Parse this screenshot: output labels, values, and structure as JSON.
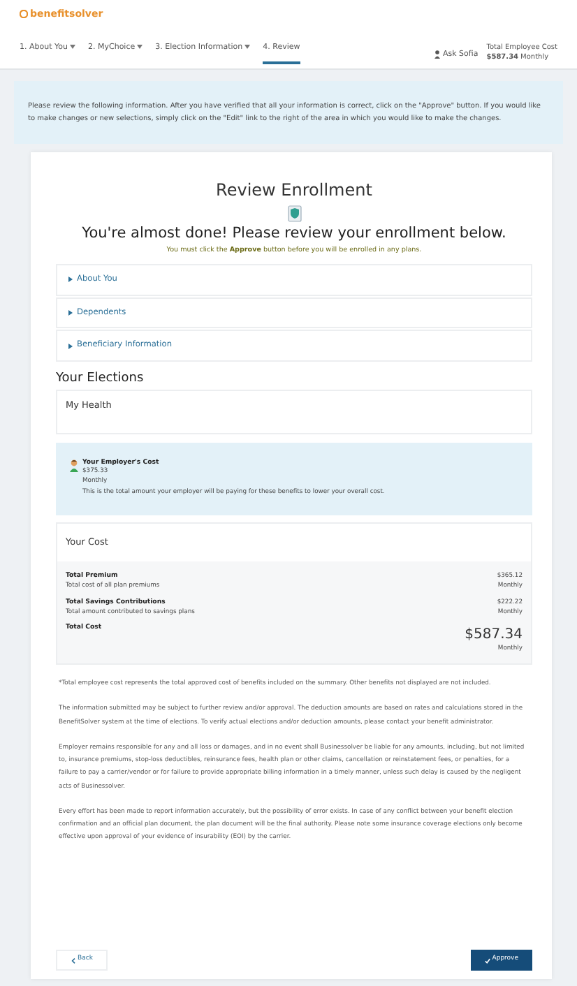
{
  "header": {
    "logo": "benefitsolver",
    "steps": [
      {
        "label": "1. About You",
        "has_menu": true,
        "selected": false
      },
      {
        "label": "2. MyChoice",
        "has_menu": true,
        "selected": false
      },
      {
        "label": "3. Election Information",
        "has_menu": true,
        "selected": false
      },
      {
        "label": "4. Review",
        "has_menu": false,
        "selected": true
      }
    ],
    "help_link": "Ask Sofia",
    "total_label": "Total Employee Cost",
    "total_amount": "$587.34",
    "total_period": "Monthly"
  },
  "banner": "Please review the following information. After you have verified that all your information is correct, click on the \"Approve\" button. If you would like to make changes or new selections, simply click on the \"Edit\" link to the right of the area in which you would like to make the changes.",
  "review": {
    "title": "Review Enrollment",
    "heading": "You're almost done! Please review your enrollment below.",
    "note": "You must click the **Approve** button before you will be enrolled in any plans.",
    "sections": [
      {
        "label": "About You",
        "expanded": false
      },
      {
        "label": "Dependents",
        "expanded": false
      },
      {
        "label": "Beneficiary Information",
        "expanded": false
      }
    ]
  },
  "elections": {
    "title": "Your Elections",
    "group": "My Health",
    "employer": {
      "title": "Your Employer's Cost",
      "amount": "$375.33",
      "period": "Monthly",
      "description": "This is the total amount your employer will be paying for these benefits to lower your overall cost."
    },
    "cost": {
      "title": "Your Cost",
      "rows": [
        {
          "kind": "line",
          "label": "Total Premium",
          "sublabel": "Total cost of all plan premiums",
          "amount": "$365.12",
          "period": "Monthly"
        },
        {
          "kind": "line",
          "label": "Total Savings Contributions",
          "sublabel": "Total amount contributed to savings plans",
          "amount": "$222.22",
          "period": "Monthly"
        },
        {
          "kind": "total",
          "label": "Total Cost",
          "amount": "$587.34",
          "period": "Monthly"
        }
      ]
    }
  },
  "disclaimers": [
    "*Total employee cost represents the total approved cost of benefits included on the summary. Other benefits not displayed are not included.",
    "The information submitted may be subject to further review and/or approval. The deduction amounts are based on rates and calculations stored in the BenefitSolver system at the time of elections. To verify actual elections and/or deduction amounts, please contact your benefit administrator.",
    "Employer remains responsible for any and all loss or damages, and in no event shall Businessolver be liable for any amounts, including, but not limited to, insurance premiums, stop-loss deductibles, reinsurance fees, health plan or other claims, cancellation or reinstatement fees, or penalties, for a failure to pay a carrier/vendor or for failure to provide appropriate billing information in a timely manner, unless such delay is caused by the negligent acts of Businessolver.",
    "Every effort has been made to report information accurately, but the possibility of error exists. In case of any conflict between your benefit election confirmation and an official plan document, the plan document will be the final authority. Please note some insurance coverage elections only become effective upon approval of your evidence of insurability (EOI) by the carrier."
  ],
  "buttons": {
    "back": "Back",
    "approve": "Approve"
  }
}
